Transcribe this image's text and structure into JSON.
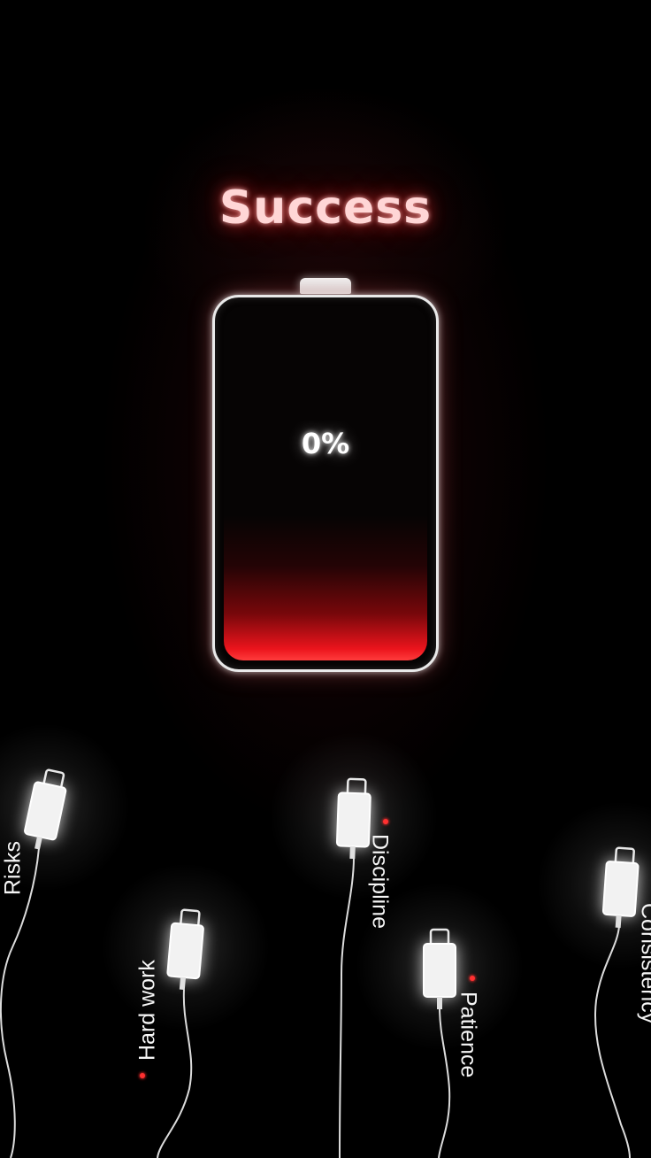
{
  "title": "Success",
  "battery": {
    "level_percent": 0,
    "level_label": "0%"
  },
  "chargers": [
    {
      "label": "Risks"
    },
    {
      "label": "Hard work"
    },
    {
      "label": "Discipline"
    },
    {
      "label": "Patience"
    },
    {
      "label": "Consistency"
    }
  ],
  "colors": {
    "background": "#000000",
    "accent_red": "#e8141c",
    "glow_white": "#ffffff",
    "title_pink": "#ffd6d6"
  }
}
